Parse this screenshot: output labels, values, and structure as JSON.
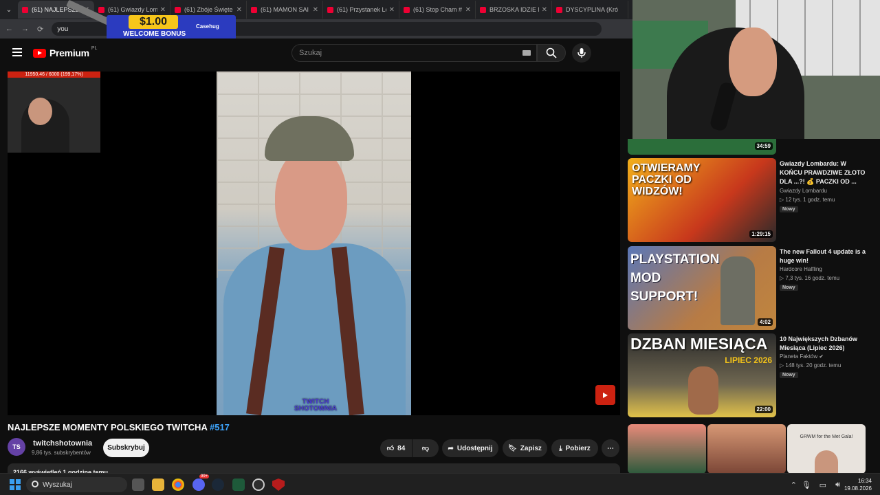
{
  "browser": {
    "tabs": [
      {
        "title": "(61) NAJLEPSZE M",
        "active": true
      },
      {
        "title": "(61) Gwiazdy Lom",
        "active": false
      },
      {
        "title": "(61) Zbóje Święte",
        "active": false
      },
      {
        "title": "(61) MAMON SAI",
        "active": false
      },
      {
        "title": "(61) Przystanek Lo",
        "active": false
      },
      {
        "title": "(61) Stop Cham #",
        "active": false
      },
      {
        "title": "BRZOSKA IDZIE N",
        "active": false
      },
      {
        "title": "DYSCYPLINA (Kró",
        "active": false
      }
    ],
    "address": "you",
    "ad": {
      "amount": "$1.00",
      "label": "WELCOME BONUS",
      "brand": "Casehug"
    }
  },
  "youtube": {
    "logo_text": "Premium",
    "region": "PL",
    "search_placeholder": "Szukaj",
    "colors": {
      "accent": "#ff0000",
      "link": "#3ea6ff"
    }
  },
  "player": {
    "cam_bar": "11950,46 / 6000 (199,17%)",
    "watermark": "TWITCH SHOTOWNIA"
  },
  "video": {
    "title": "NAJLEPSZE MOMENTY POLSKIEGO TWITCHA",
    "title_tag": "#517",
    "channel": "twitchshotownia",
    "subscribers": "9,86 tys. subskrybentów",
    "subscribe_label": "Subskrybuj",
    "likes": "84",
    "share_label": "Udostępnij",
    "save_label": "Zapisz",
    "download_label": "Pobierz",
    "description_preview": "2166 wyświetleń  1 godzinę temu"
  },
  "stream": {
    "duration": "34:59"
  },
  "recommendations": [
    {
      "title": "Gwiazdy Lombardu: W KOŃCU PRAWDZIWE ZŁOTO DLA ...?! 💰 PACZKI OD ...",
      "channel": "Gwiazdy Lombardu",
      "meta": "▷ 12 tys.   1 godz. temu",
      "badge": "Nowy",
      "duration": "1:29:15",
      "thumb_text": "OTWIERAMY PACZKI OD WIDZÓW!"
    },
    {
      "title": "The new Fallout 4 update is a huge win!",
      "channel": "Hardcore Halfling",
      "meta": "▷ 7,3 tys.   16 godz. temu",
      "badge": "Nowy",
      "duration": "4:02",
      "thumb_text": "PLAYSTATION MOD SUPPORT!"
    },
    {
      "title": "10 Największych Dzbanów Miesiąca (Lipiec 2026)",
      "channel": "Planeta Faktów",
      "meta": "▷ 148 tys.   20 godz. temu",
      "badge": "Nowy",
      "duration": "22:00",
      "thumb_text": "DZBAN MIESIĄCA",
      "thumb_sub": "LIPIEC 2026"
    }
  ],
  "shorts": [
    {
      "text": ""
    },
    {
      "text": ""
    },
    {
      "text": "GRWM for the Met Gala!"
    }
  ],
  "taskbar": {
    "search_placeholder": "Wyszukaj",
    "time": "16:34",
    "date": "19.08.2026",
    "badge": "99+"
  }
}
